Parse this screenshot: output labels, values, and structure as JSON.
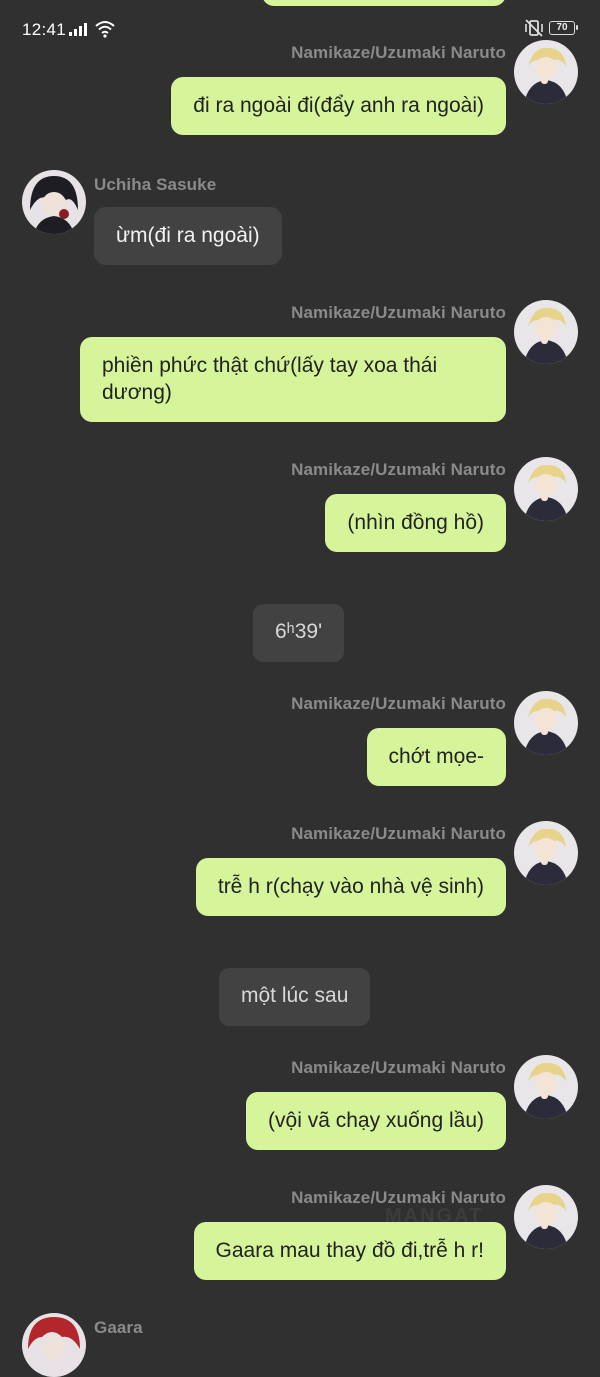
{
  "status_bar": {
    "time": "12:41",
    "battery": "70"
  },
  "messages": [
    {
      "id": "m1",
      "side": "right",
      "sender": "Namikaze/Uzumaki Naruto",
      "text": "đi ra ngoài đi(đẩy anh ra ngoài)"
    },
    {
      "id": "m2",
      "side": "left",
      "sender": "Uchiha Sasuke",
      "text": "ừm(đi ra ngoài)"
    },
    {
      "id": "m3",
      "side": "right",
      "sender": "Namikaze/Uzumaki Naruto",
      "text": "phiền phức thật chứ(lấy tay xoa thái dương)"
    },
    {
      "id": "m4",
      "side": "right",
      "sender": "Namikaze/Uzumaki Naruto",
      "text": "(nhìn đồng hồ)"
    },
    {
      "id": "n1",
      "side": "center",
      "text": "6ʰ39'"
    },
    {
      "id": "m5",
      "side": "right",
      "sender": "Namikaze/Uzumaki Naruto",
      "text": "chớt mọe-"
    },
    {
      "id": "m6",
      "side": "right",
      "sender": "Namikaze/Uzumaki Naruto",
      "text": "trễ h r(chạy vào nhà vệ sinh)"
    },
    {
      "id": "n2",
      "side": "center",
      "text": "một lúc sau"
    },
    {
      "id": "m7",
      "side": "right",
      "sender": "Namikaze/Uzumaki Naruto",
      "text": "(vội vã chạy xuống lầu)"
    },
    {
      "id": "m8",
      "side": "right",
      "sender": "Namikaze/Uzumaki Naruto",
      "text": "Gaara mau thay đồ đi,trễ h r!"
    },
    {
      "id": "m9",
      "side": "left",
      "sender": "Gaara"
    }
  ],
  "watermark": "MANGAT",
  "colors": {
    "background": "#303030",
    "own_bubble": "#d6f59a",
    "other_bubble": "#424242",
    "sender_name": "#8a8a8a"
  },
  "icons": {
    "signal": "signal-bars-icon",
    "wifi": "wifi-icon",
    "vibrate": "vibrate-off-icon",
    "battery": "battery-icon"
  }
}
